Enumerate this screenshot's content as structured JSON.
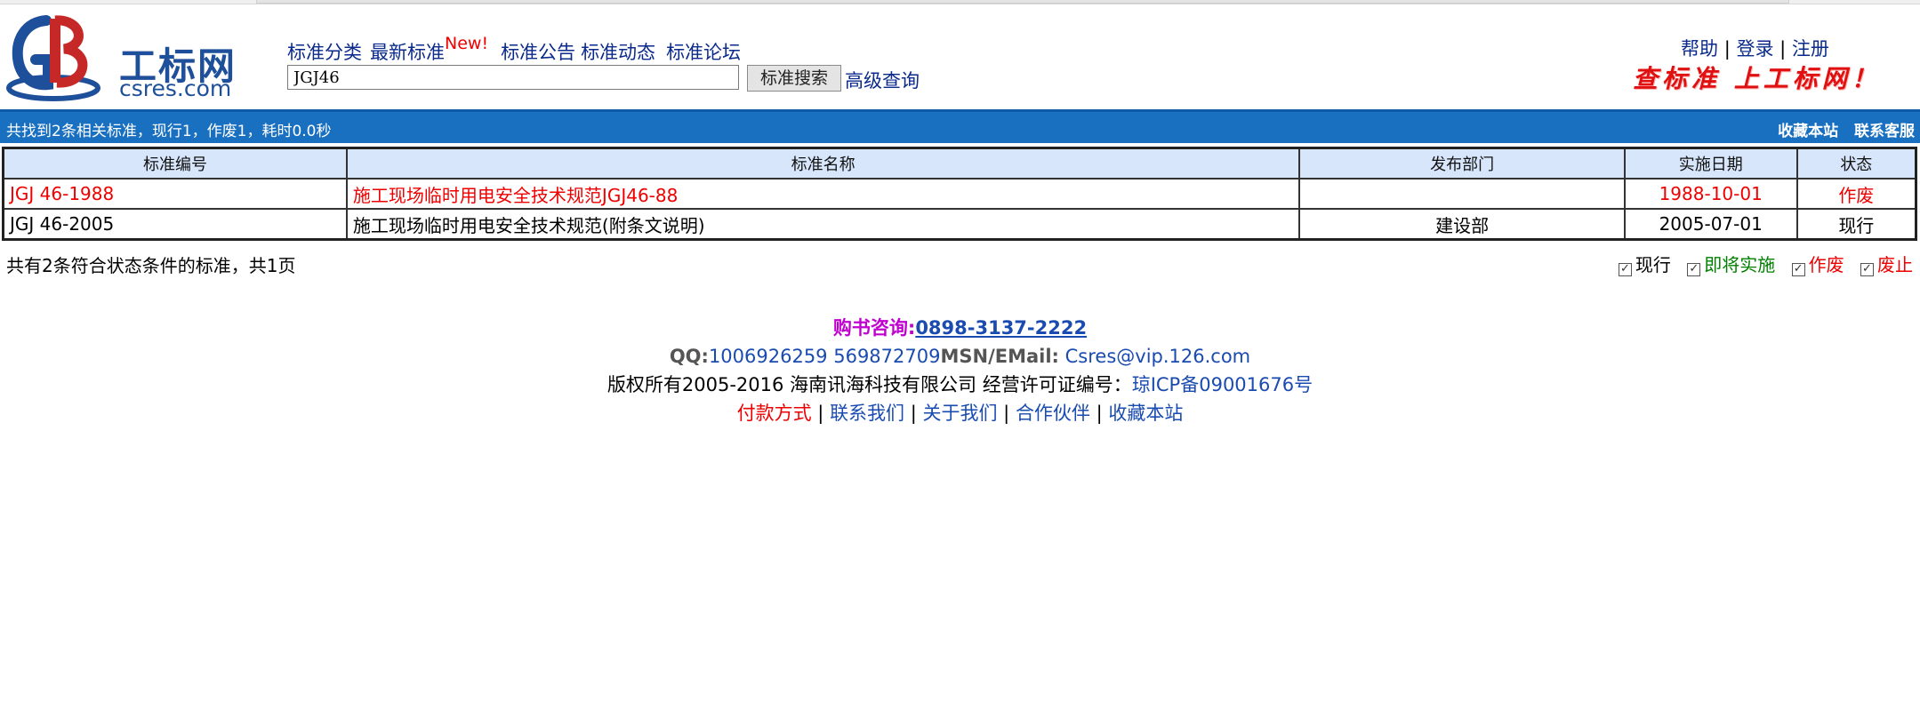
{
  "header": {
    "logo_cn": "工标网",
    "logo_en": "csres.com",
    "nav": [
      {
        "label": "标准分类"
      },
      {
        "label": "最新标准",
        "badge": "New!"
      },
      {
        "label": "标准公告"
      },
      {
        "label": "标准动态"
      },
      {
        "label": "标准论坛"
      }
    ],
    "search_value": "JGJ46",
    "search_button": "标准搜索",
    "advanced_search": "高级查询",
    "toplinks": {
      "help": "帮助",
      "login": "登录",
      "register": "注册",
      "sep": "|"
    },
    "slogan": "查标准 上工标网！"
  },
  "bar": {
    "summary": "共找到2条相关标准，现行1，作废1，耗时0.0秒",
    "bookmark": "收藏本站",
    "service": "联系客服"
  },
  "table": {
    "headers": [
      "标准编号",
      "标准名称",
      "发布部门",
      "实施日期",
      "状态"
    ],
    "rows": [
      {
        "code": "JGJ 46-1988",
        "name": "施工现场临时用电安全技术规范JGJ46-88",
        "dept": "",
        "date": "1988-10-01",
        "status": "作废"
      },
      {
        "code": "JGJ 46-2005",
        "name": "施工现场临时用电安全技术规范(附条文说明)",
        "dept": "建设部",
        "date": "2005-07-01",
        "status": "现行"
      }
    ]
  },
  "results_footer": "共有2条符合状态条件的标准，共1页",
  "legend": [
    {
      "label": "现行",
      "color": "#000000",
      "checked": true
    },
    {
      "label": "即将实施",
      "color": "#008000",
      "checked": true
    },
    {
      "label": "作废",
      "color": "#e00000",
      "checked": true
    },
    {
      "label": "废止",
      "color": "#e00000",
      "checked": true
    }
  ],
  "footer": {
    "consult_label": "购书咨询:",
    "consult_phone": "0898-3137-2222",
    "qq_label": "QQ:",
    "qq_value": "1006926259 569872709",
    "msn_label": "MSN/EMail:",
    "msn_value": " Csres@vip.126.com",
    "copyright": "版权所有2005-2016 海南讯海科技有限公司 经营许可证编号：",
    "icp": "琼ICP备09001676号",
    "links": [
      "付款方式",
      "联系我们",
      "关于我们",
      "合作伙伴",
      "收藏本站"
    ],
    "sep": " | "
  }
}
